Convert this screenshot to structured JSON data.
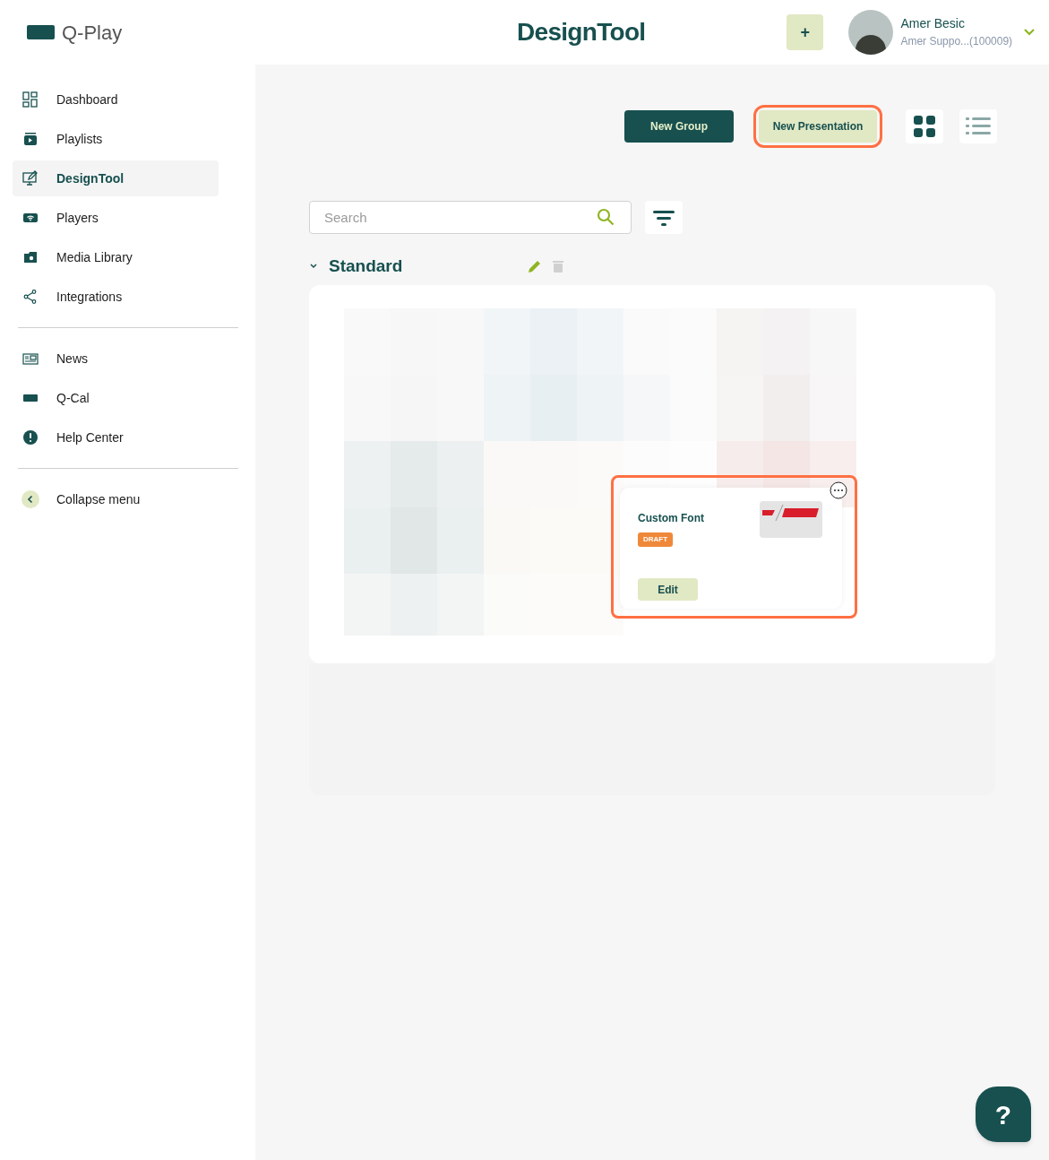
{
  "brand": {
    "name": "Q-Play"
  },
  "header": {
    "title": "DesignTool",
    "add_button": "+",
    "user": {
      "name": "Amer Besic",
      "account": "Amer Suppo...(100009)"
    }
  },
  "sidebar": {
    "groups": [
      [
        {
          "kind": "dashboard",
          "label": "Dashboard",
          "selected": false
        },
        {
          "kind": "playlists",
          "label": "Playlists",
          "selected": false
        },
        {
          "kind": "designtool",
          "label": "DesignTool",
          "selected": true
        },
        {
          "kind": "players",
          "label": "Players",
          "selected": false
        },
        {
          "kind": "media",
          "label": "Media Library",
          "selected": false
        },
        {
          "kind": "integrations",
          "label": "Integrations",
          "selected": false
        }
      ],
      [
        {
          "kind": "news",
          "label": "News",
          "selected": false
        },
        {
          "kind": "qcal",
          "label": "Q-Cal",
          "selected": false
        },
        {
          "kind": "help",
          "label": "Help Center",
          "selected": false
        }
      ],
      [
        {
          "kind": "collapse",
          "label": "Collapse menu",
          "selected": false
        }
      ]
    ]
  },
  "toolbar": {
    "buttons": [
      {
        "kind": "primary",
        "label": "New Group",
        "highlighted": false
      },
      {
        "kind": "secondary",
        "label": "New Presentation",
        "highlighted": true
      }
    ],
    "views": [
      {
        "kind": "grid",
        "selected": true
      },
      {
        "kind": "list",
        "selected": false
      }
    ]
  },
  "search": {
    "placeholder": "Search"
  },
  "group": {
    "title": "Standard",
    "expanded": true,
    "presentations": [
      {
        "title": "Custom Font",
        "status": "DRAFT",
        "action": "Edit",
        "highlighted": true
      }
    ]
  },
  "help_button": "?"
}
